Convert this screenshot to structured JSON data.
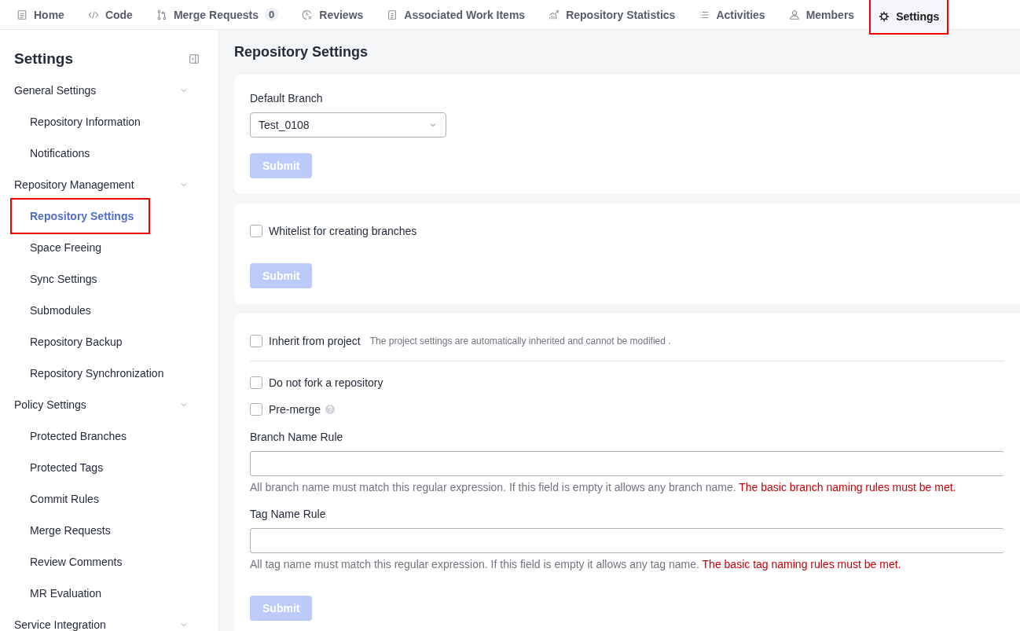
{
  "tabs": [
    {
      "label": "Home",
      "selected": false,
      "highlighted": false
    },
    {
      "label": "Code",
      "selected": false,
      "highlighted": false
    },
    {
      "label": "Merge Requests",
      "badge": "0",
      "selected": false,
      "highlighted": false
    },
    {
      "label": "Reviews",
      "selected": false,
      "highlighted": false
    },
    {
      "label": "Associated Work Items",
      "selected": false,
      "highlighted": false
    },
    {
      "label": "Repository Statistics",
      "selected": false,
      "highlighted": false
    },
    {
      "label": "Activities",
      "selected": false,
      "highlighted": false
    },
    {
      "label": "Members",
      "selected": false,
      "highlighted": false
    },
    {
      "label": "Settings",
      "selected": true,
      "highlighted": true
    }
  ],
  "sidebar": {
    "title": "Settings",
    "groups": [
      {
        "label": "General Settings",
        "expanded": true,
        "children": [
          {
            "label": "Repository Information",
            "selected": false,
            "highlighted": false
          },
          {
            "label": "Notifications",
            "selected": false,
            "highlighted": false
          }
        ]
      },
      {
        "label": "Repository Management",
        "expanded": true,
        "children": [
          {
            "label": "Repository Settings",
            "selected": true,
            "highlighted": true
          },
          {
            "label": "Space Freeing",
            "selected": false,
            "highlighted": false
          },
          {
            "label": "Sync Settings",
            "selected": false,
            "highlighted": false
          },
          {
            "label": "Submodules",
            "selected": false,
            "highlighted": false
          },
          {
            "label": "Repository Backup",
            "selected": false,
            "highlighted": false
          },
          {
            "label": "Repository Synchronization",
            "selected": false,
            "highlighted": false
          }
        ]
      },
      {
        "label": "Policy Settings",
        "expanded": true,
        "children": [
          {
            "label": "Protected Branches",
            "selected": false,
            "highlighted": false
          },
          {
            "label": "Protected Tags",
            "selected": false,
            "highlighted": false
          },
          {
            "label": "Commit Rules",
            "selected": false,
            "highlighted": false
          },
          {
            "label": "Merge Requests",
            "selected": false,
            "highlighted": false
          },
          {
            "label": "Review Comments",
            "selected": false,
            "highlighted": false
          },
          {
            "label": "MR Evaluation",
            "selected": false,
            "highlighted": false
          }
        ]
      },
      {
        "label": "Service Integration",
        "expanded": true
      }
    ]
  },
  "main": {
    "title": "Repository Settings",
    "cards": [
      {
        "items": [
          {
            "kind": "select",
            "label": "Default Branch",
            "value": "Test_0108"
          },
          {
            "kind": "button",
            "label": "Submit",
            "disabled": true
          }
        ]
      },
      {
        "items": [
          {
            "kind": "checkbox",
            "label": "Whitelist for creating branches",
            "checked": false
          },
          {
            "kind": "button",
            "label": "Submit",
            "disabled": true
          }
        ]
      },
      {
        "items": [
          {
            "kind": "checkbox",
            "label": "Inherit from project",
            "note": "The project settings are automatically inherited and cannot be modified .",
            "checked": false
          },
          {
            "kind": "divider"
          },
          {
            "kind": "checkbox",
            "label": "Do not fork a repository",
            "checked": false
          },
          {
            "kind": "checkbox",
            "label": "Pre-merge",
            "help": true,
            "checked": false
          },
          {
            "kind": "input",
            "label": "Branch Name Rule",
            "hint": "All branch name must match this regular expression. If this field is empty it allows any branch name.",
            "warning": "The basic branch naming rules must be met."
          },
          {
            "kind": "input",
            "label": "Tag Name Rule",
            "hint": "All tag name must match this regular expression. If this field is empty it allows any tag name.",
            "warning": "The basic tag naming rules must be met."
          },
          {
            "kind": "button",
            "label": "Submit",
            "disabled": true
          }
        ]
      }
    ]
  }
}
